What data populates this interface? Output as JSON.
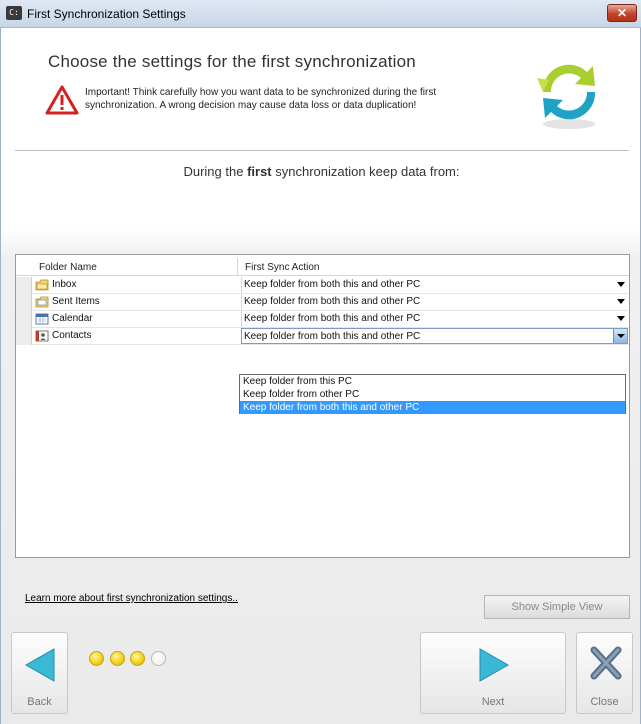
{
  "window": {
    "title": "First Synchronization Settings",
    "close_label": "✕"
  },
  "header": {
    "title": "Choose the settings for the first synchronization",
    "warning": "Important! Think carefully how you want data to be synchronized during the first synchronization. A wrong decision may cause data loss or data duplication!"
  },
  "subheading": {
    "before": "During the ",
    "bold": "first",
    "after": " synchronization keep data from:"
  },
  "grid": {
    "columns": [
      "Folder Name",
      "First Sync Action"
    ],
    "rows": [
      {
        "name": "Inbox",
        "icon": "inbox-folder-icon",
        "action": "Keep folder from both this and other PC"
      },
      {
        "name": "Sent Items",
        "icon": "sent-items-folder-icon",
        "action": "Keep folder from both this and other PC"
      },
      {
        "name": "Calendar",
        "icon": "calendar-icon",
        "action": "Keep folder from both this and other PC"
      },
      {
        "name": "Contacts",
        "icon": "contacts-icon",
        "action": "Keep folder from both this and other PC"
      }
    ],
    "dropdown_options": [
      "Keep folder from this PC",
      "Keep folder from other PC",
      "Keep folder from both this and other PC"
    ],
    "dropdown_selected_index": 2
  },
  "footer": {
    "learn_more": "Learn more about first synchronization settings..",
    "simple_view": "Show Simple View",
    "back": "Back",
    "next": "Next",
    "close": "Close",
    "progress_steps_total": 4,
    "progress_steps_done": 3
  },
  "colors": {
    "accent": "#1fa3c4",
    "selection": "#3399ff",
    "warning": "#d62020",
    "dot_on": "#f2d21a"
  }
}
